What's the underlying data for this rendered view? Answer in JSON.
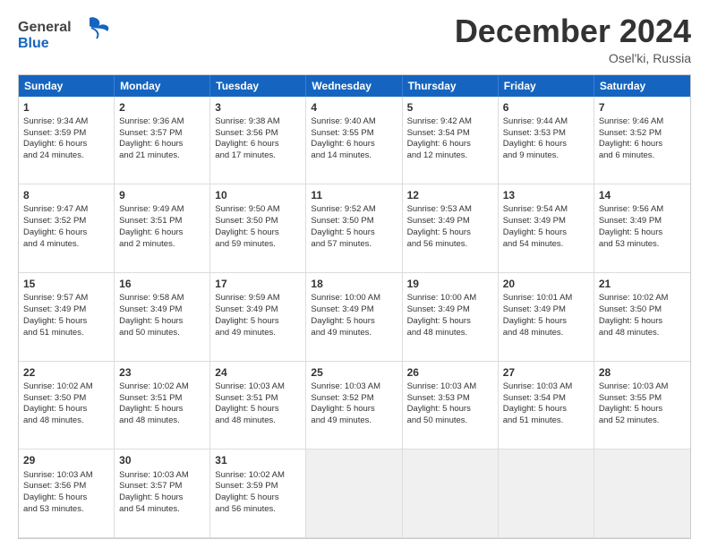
{
  "logo": {
    "line1": "General",
    "line2": "Blue"
  },
  "title": "December 2024",
  "location": "Osel'ki, Russia",
  "header_days": [
    "Sunday",
    "Monday",
    "Tuesday",
    "Wednesday",
    "Thursday",
    "Friday",
    "Saturday"
  ],
  "weeks": [
    [
      {
        "day": "1",
        "lines": [
          "Sunrise: 9:34 AM",
          "Sunset: 3:59 PM",
          "Daylight: 6 hours",
          "and 24 minutes."
        ]
      },
      {
        "day": "2",
        "lines": [
          "Sunrise: 9:36 AM",
          "Sunset: 3:57 PM",
          "Daylight: 6 hours",
          "and 21 minutes."
        ]
      },
      {
        "day": "3",
        "lines": [
          "Sunrise: 9:38 AM",
          "Sunset: 3:56 PM",
          "Daylight: 6 hours",
          "and 17 minutes."
        ]
      },
      {
        "day": "4",
        "lines": [
          "Sunrise: 9:40 AM",
          "Sunset: 3:55 PM",
          "Daylight: 6 hours",
          "and 14 minutes."
        ]
      },
      {
        "day": "5",
        "lines": [
          "Sunrise: 9:42 AM",
          "Sunset: 3:54 PM",
          "Daylight: 6 hours",
          "and 12 minutes."
        ]
      },
      {
        "day": "6",
        "lines": [
          "Sunrise: 9:44 AM",
          "Sunset: 3:53 PM",
          "Daylight: 6 hours",
          "and 9 minutes."
        ]
      },
      {
        "day": "7",
        "lines": [
          "Sunrise: 9:46 AM",
          "Sunset: 3:52 PM",
          "Daylight: 6 hours",
          "and 6 minutes."
        ]
      }
    ],
    [
      {
        "day": "8",
        "lines": [
          "Sunrise: 9:47 AM",
          "Sunset: 3:52 PM",
          "Daylight: 6 hours",
          "and 4 minutes."
        ]
      },
      {
        "day": "9",
        "lines": [
          "Sunrise: 9:49 AM",
          "Sunset: 3:51 PM",
          "Daylight: 6 hours",
          "and 2 minutes."
        ]
      },
      {
        "day": "10",
        "lines": [
          "Sunrise: 9:50 AM",
          "Sunset: 3:50 PM",
          "Daylight: 5 hours",
          "and 59 minutes."
        ]
      },
      {
        "day": "11",
        "lines": [
          "Sunrise: 9:52 AM",
          "Sunset: 3:50 PM",
          "Daylight: 5 hours",
          "and 57 minutes."
        ]
      },
      {
        "day": "12",
        "lines": [
          "Sunrise: 9:53 AM",
          "Sunset: 3:49 PM",
          "Daylight: 5 hours",
          "and 56 minutes."
        ]
      },
      {
        "day": "13",
        "lines": [
          "Sunrise: 9:54 AM",
          "Sunset: 3:49 PM",
          "Daylight: 5 hours",
          "and 54 minutes."
        ]
      },
      {
        "day": "14",
        "lines": [
          "Sunrise: 9:56 AM",
          "Sunset: 3:49 PM",
          "Daylight: 5 hours",
          "and 53 minutes."
        ]
      }
    ],
    [
      {
        "day": "15",
        "lines": [
          "Sunrise: 9:57 AM",
          "Sunset: 3:49 PM",
          "Daylight: 5 hours",
          "and 51 minutes."
        ]
      },
      {
        "day": "16",
        "lines": [
          "Sunrise: 9:58 AM",
          "Sunset: 3:49 PM",
          "Daylight: 5 hours",
          "and 50 minutes."
        ]
      },
      {
        "day": "17",
        "lines": [
          "Sunrise: 9:59 AM",
          "Sunset: 3:49 PM",
          "Daylight: 5 hours",
          "and 49 minutes."
        ]
      },
      {
        "day": "18",
        "lines": [
          "Sunrise: 10:00 AM",
          "Sunset: 3:49 PM",
          "Daylight: 5 hours",
          "and 49 minutes."
        ]
      },
      {
        "day": "19",
        "lines": [
          "Sunrise: 10:00 AM",
          "Sunset: 3:49 PM",
          "Daylight: 5 hours",
          "and 48 minutes."
        ]
      },
      {
        "day": "20",
        "lines": [
          "Sunrise: 10:01 AM",
          "Sunset: 3:49 PM",
          "Daylight: 5 hours",
          "and 48 minutes."
        ]
      },
      {
        "day": "21",
        "lines": [
          "Sunrise: 10:02 AM",
          "Sunset: 3:50 PM",
          "Daylight: 5 hours",
          "and 48 minutes."
        ]
      }
    ],
    [
      {
        "day": "22",
        "lines": [
          "Sunrise: 10:02 AM",
          "Sunset: 3:50 PM",
          "Daylight: 5 hours",
          "and 48 minutes."
        ]
      },
      {
        "day": "23",
        "lines": [
          "Sunrise: 10:02 AM",
          "Sunset: 3:51 PM",
          "Daylight: 5 hours",
          "and 48 minutes."
        ]
      },
      {
        "day": "24",
        "lines": [
          "Sunrise: 10:03 AM",
          "Sunset: 3:51 PM",
          "Daylight: 5 hours",
          "and 48 minutes."
        ]
      },
      {
        "day": "25",
        "lines": [
          "Sunrise: 10:03 AM",
          "Sunset: 3:52 PM",
          "Daylight: 5 hours",
          "and 49 minutes."
        ]
      },
      {
        "day": "26",
        "lines": [
          "Sunrise: 10:03 AM",
          "Sunset: 3:53 PM",
          "Daylight: 5 hours",
          "and 50 minutes."
        ]
      },
      {
        "day": "27",
        "lines": [
          "Sunrise: 10:03 AM",
          "Sunset: 3:54 PM",
          "Daylight: 5 hours",
          "and 51 minutes."
        ]
      },
      {
        "day": "28",
        "lines": [
          "Sunrise: 10:03 AM",
          "Sunset: 3:55 PM",
          "Daylight: 5 hours",
          "and 52 minutes."
        ]
      }
    ],
    [
      {
        "day": "29",
        "lines": [
          "Sunrise: 10:03 AM",
          "Sunset: 3:56 PM",
          "Daylight: 5 hours",
          "and 53 minutes."
        ]
      },
      {
        "day": "30",
        "lines": [
          "Sunrise: 10:03 AM",
          "Sunset: 3:57 PM",
          "Daylight: 5 hours",
          "and 54 minutes."
        ]
      },
      {
        "day": "31",
        "lines": [
          "Sunrise: 10:02 AM",
          "Sunset: 3:59 PM",
          "Daylight: 5 hours",
          "and 56 minutes."
        ]
      },
      {
        "day": "",
        "lines": []
      },
      {
        "day": "",
        "lines": []
      },
      {
        "day": "",
        "lines": []
      },
      {
        "day": "",
        "lines": []
      }
    ]
  ]
}
